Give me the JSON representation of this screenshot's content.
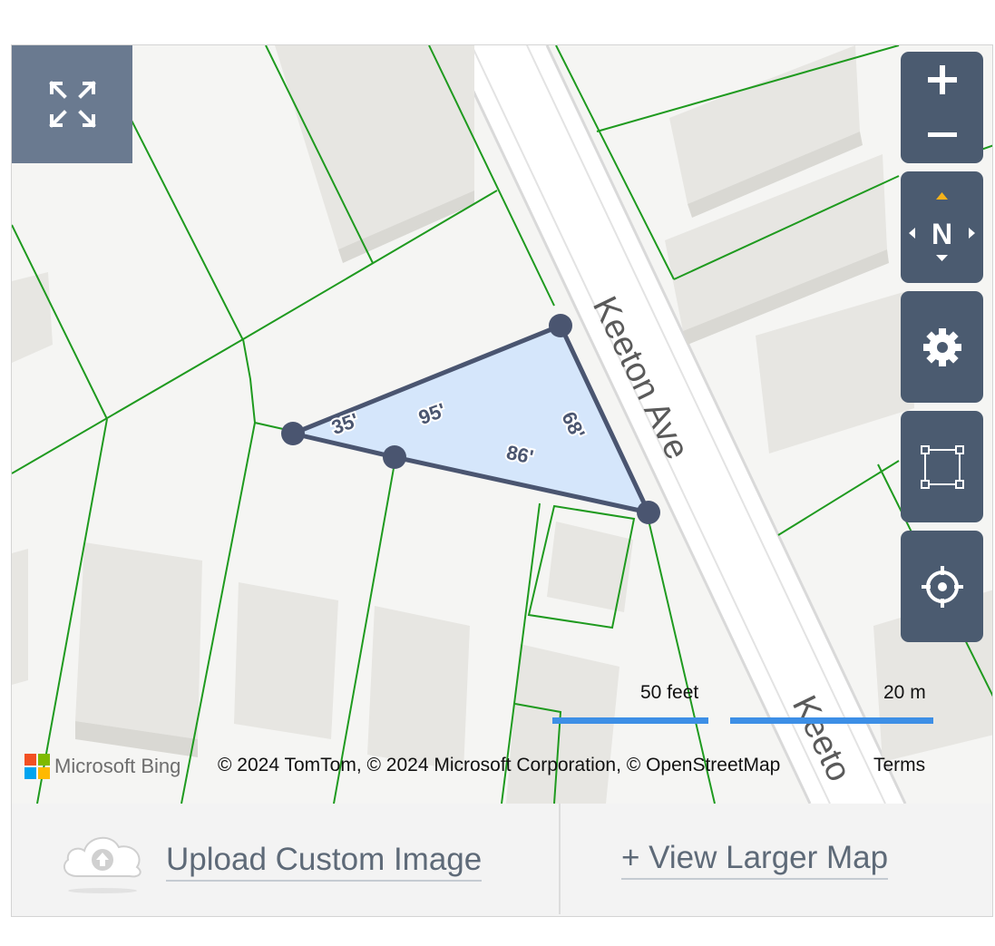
{
  "map": {
    "street_label_1": "Keeton Ave",
    "street_label_2": "Keeto",
    "measurements": [
      "35'",
      "95'",
      "68'",
      "86'"
    ]
  },
  "controls": {
    "zoom_in": "+",
    "zoom_out": "−",
    "compass_letter": "N"
  },
  "scale": {
    "feet_label": "50 feet",
    "meters_label": "20 m"
  },
  "attribution": {
    "brand": "Microsoft Bing",
    "text": "© 2024 TomTom, © 2024 Microsoft Corporation, © OpenStreetMap",
    "terms": "Terms"
  },
  "footer": {
    "upload_label": "Upload Custom Image",
    "view_larger_label": "+ View Larger Map"
  },
  "colors": {
    "parcel_lines": "#1f9a1f",
    "controls_bg": "#4b5b70",
    "selection_fill": "#cfe3fb",
    "scale_bar": "#3d8fe6",
    "compass_north": "#f5b21a"
  }
}
